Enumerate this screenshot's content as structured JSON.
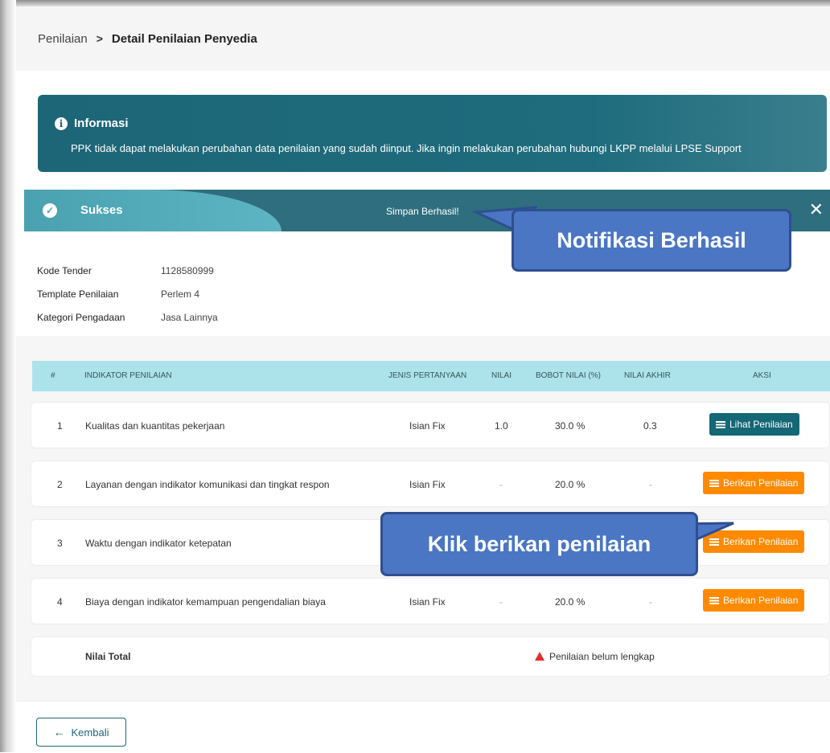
{
  "breadcrumb": {
    "parent": "Penilaian",
    "separator": ">",
    "current": "Detail Penilaian Penyedia"
  },
  "info": {
    "title": "Informasi",
    "text": "PPK tidak dapat melakukan perubahan data penilaian yang sudah diinput. Jika ingin melakukan perubahan hubungi LKPP melalui LPSE Support"
  },
  "success": {
    "title": "Sukses",
    "message": "Simpan Berhasil!",
    "close": "✕"
  },
  "meta": [
    {
      "label": "Kode Tender",
      "value": "1128580999"
    },
    {
      "label": "Template Penilaian",
      "value": "Perlem 4"
    },
    {
      "label": "Kategori Pengadaan",
      "value": "Jasa Lainnya"
    }
  ],
  "table": {
    "headers": {
      "no": "#",
      "indikator": "INDIKATOR PENILAIAN",
      "jenis": "JENIS PERTANYAAN",
      "nilai": "NILAI",
      "bobot": "BOBOT NILAI (%)",
      "akhir": "NILAI AKHIR",
      "aksi": "AKSI"
    },
    "rows": [
      {
        "no": "1",
        "indikator": "Kualitas dan kuantitas pekerjaan",
        "jenis": "Isian Fix",
        "nilai": "1.0",
        "bobot": "30.0 %",
        "akhir": "0.3",
        "aksi": "Lihat Penilaian"
      },
      {
        "no": "2",
        "indikator": "Layanan dengan indikator komunikasi dan tingkat respon",
        "jenis": "Isian Fix",
        "nilai": "-",
        "bobot": "20.0 %",
        "akhir": "-",
        "aksi": "Berikan Penilaian"
      },
      {
        "no": "3",
        "indikator": "Waktu dengan indikator ketepatan",
        "jenis": "",
        "nilai": "",
        "bobot": "",
        "akhir": "",
        "aksi": "Berikan Penilaian"
      },
      {
        "no": "4",
        "indikator": "Biaya dengan indikator kemampuan pengendalian biaya",
        "jenis": "Isian Fix",
        "nilai": "-",
        "bobot": "20.0 %",
        "akhir": "-",
        "aksi": "Berikan Penilaian"
      }
    ],
    "total_label": "Nilai Total",
    "total_status": "Penilaian belum lengkap"
  },
  "back_button": "Kembali",
  "callouts": {
    "notif": "Notifikasi Berhasil",
    "click": "Klik berikan penilaian"
  },
  "colors": {
    "teal": "#1d6677",
    "orange": "#ff8a00",
    "header_bg": "#ace3ea",
    "callout": "#4a76c4"
  }
}
